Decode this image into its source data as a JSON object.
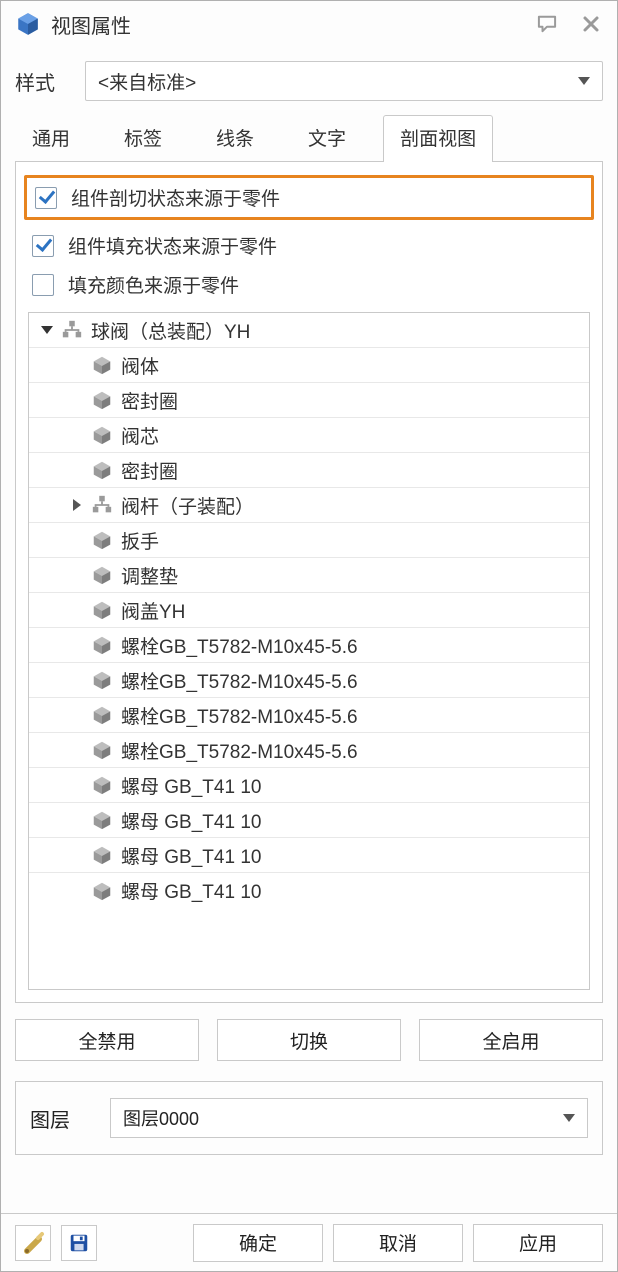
{
  "titlebar": {
    "title": "视图属性"
  },
  "style": {
    "label": "样式",
    "value": "<来自标准>"
  },
  "tabs": [
    {
      "id": "general",
      "label": "通用",
      "active": false
    },
    {
      "id": "tags",
      "label": "标签",
      "active": false
    },
    {
      "id": "lines",
      "label": "线条",
      "active": false
    },
    {
      "id": "text",
      "label": "文字",
      "active": false
    },
    {
      "id": "section",
      "label": "剖面视图",
      "active": true
    }
  ],
  "checks": {
    "cut_from_part": {
      "label": "组件剖切状态来源于零件",
      "checked": true,
      "highlight": true
    },
    "fill_from_part": {
      "label": "组件填充状态来源于零件",
      "checked": true,
      "highlight": false
    },
    "color_from_part": {
      "label": "填充颜色来源于零件",
      "checked": false,
      "highlight": false
    }
  },
  "tree": [
    {
      "indent": 0,
      "expander": "open",
      "icon": "assembly",
      "label": "球阀（总装配）YH"
    },
    {
      "indent": 1,
      "icon": "cube",
      "label": "阀体"
    },
    {
      "indent": 1,
      "icon": "cube",
      "label": "密封圈"
    },
    {
      "indent": 1,
      "icon": "cube",
      "label": "阀芯"
    },
    {
      "indent": 1,
      "icon": "cube",
      "label": "密封圈"
    },
    {
      "indent": 1,
      "expander": "closed",
      "icon": "assembly",
      "label": "阀杆（子装配）"
    },
    {
      "indent": 1,
      "icon": "cube",
      "label": "扳手"
    },
    {
      "indent": 1,
      "icon": "cube",
      "label": "调整垫"
    },
    {
      "indent": 1,
      "icon": "cube",
      "label": "阀盖YH"
    },
    {
      "indent": 1,
      "icon": "cube",
      "label": "螺栓GB_T5782-M10x45-5.6"
    },
    {
      "indent": 1,
      "icon": "cube",
      "label": "螺栓GB_T5782-M10x45-5.6"
    },
    {
      "indent": 1,
      "icon": "cube",
      "label": "螺栓GB_T5782-M10x45-5.6"
    },
    {
      "indent": 1,
      "icon": "cube",
      "label": "螺栓GB_T5782-M10x45-5.6"
    },
    {
      "indent": 1,
      "icon": "cube",
      "label": "螺母 GB_T41 10"
    },
    {
      "indent": 1,
      "icon": "cube",
      "label": "螺母 GB_T41 10"
    },
    {
      "indent": 1,
      "icon": "cube",
      "label": "螺母 GB_T41 10"
    },
    {
      "indent": 1,
      "icon": "cube",
      "label": "螺母 GB_T41 10"
    }
  ],
  "actions": {
    "disable_all": "全禁用",
    "toggle": "切换",
    "enable_all": "全启用"
  },
  "layer": {
    "label": "图层",
    "value": "图层0000"
  },
  "footer": {
    "ok": "确定",
    "cancel": "取消",
    "apply": "应用"
  }
}
